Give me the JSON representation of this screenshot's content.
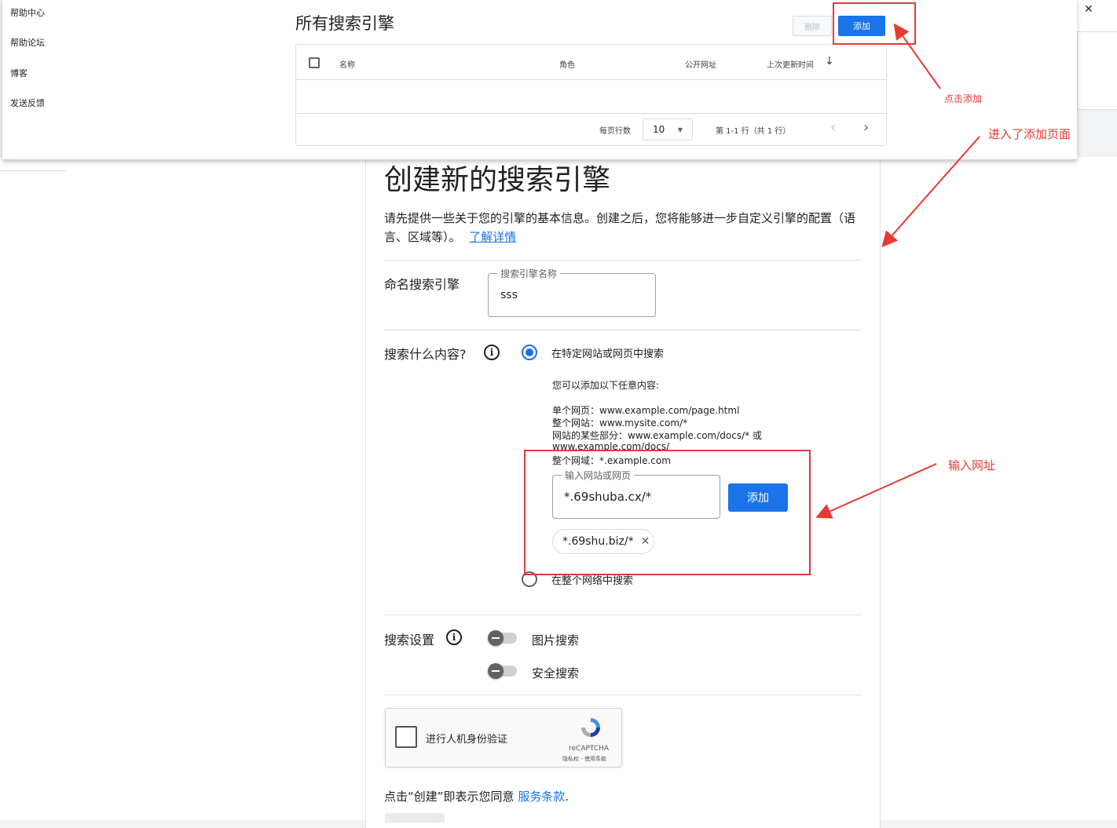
{
  "popup": {
    "help_links": [
      "帮助中心",
      "帮助论坛",
      "博客",
      "发送反馈"
    ],
    "title": "所有搜索引擎",
    "delete_label": "删除",
    "add_label": "添加",
    "columns": [
      "名称",
      "角色",
      "公开网址",
      "上次更新时间"
    ],
    "rows_per_page_label": "每页行数",
    "rows_per_page_value": "10",
    "range_text": "第 1-1 行（共 1 行）",
    "close_glyph": "✕"
  },
  "annotations": {
    "click_add": "点击添加",
    "entered_add_page": "进入了添加页面",
    "input_url": "输入网址"
  },
  "form": {
    "title": "创建新的搜索引擎",
    "intro": "请先提供一些关于您的引擎的基本信息。创建之后，您将能够进一步自定义引擎的配置（语言、区域等）。",
    "learn_more": "了解详情",
    "name_section_label": "命名搜索引擎",
    "name_field_label": "搜索引擎名称",
    "name_field_value": "sss",
    "what_label": "搜索什么内容?",
    "option_specific": "在特定网站或网页中搜索",
    "hint_title": "您可以添加以下任意内容:",
    "hint_lines": [
      "单个网页：www.example.com/page.html",
      "整个网站：www.mysite.com/*",
      "网站的某些部分：www.example.com/docs/* 或",
      "www.example.com/docs/",
      "整个网域：*.example.com"
    ],
    "site_field_label": "输入网站或网页",
    "site_field_value": "*.69shuba.cx/*",
    "site_add_label": "添加",
    "chip_value": "*.69shu.biz/*",
    "option_web": "在整个网络中搜索",
    "settings_label": "搜索设置",
    "image_search": "图片搜索",
    "safe_search": "安全搜索",
    "captcha_label": "进行人机身份验证",
    "captcha_brand": "reCAPTCHA",
    "captcha_links": "隐私权 - 使用条款",
    "terms_prefix": "点击“创建”即表示您同意",
    "terms_link": "服务条款",
    "terms_suffix": "."
  },
  "colors": {
    "accent": "#1a73e8",
    "annotation": "#e53935"
  }
}
